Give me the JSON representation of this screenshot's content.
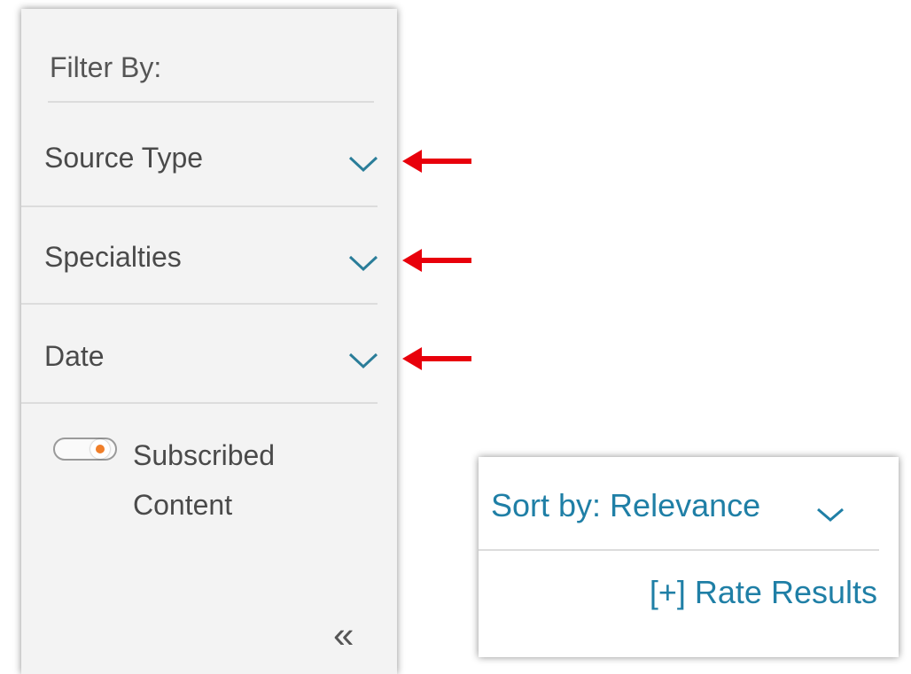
{
  "filter_panel": {
    "title": "Filter By:",
    "filters": [
      {
        "label": "Source Type",
        "icon": "chevron-down-icon"
      },
      {
        "label": "Specialties",
        "icon": "chevron-down-icon"
      },
      {
        "label": "Date",
        "icon": "chevron-down-icon"
      }
    ],
    "toggle": {
      "label_line1": "Subscribed",
      "label_line2": "Content",
      "state": "on"
    },
    "collapse_icon": "double-chevron-left-icon"
  },
  "annotations": {
    "arrow_icon": "arrow-left-icon",
    "arrow_color": "#e8000b"
  },
  "sort": {
    "label": "Sort by: Relevance",
    "icon": "chevron-down-icon",
    "rate_results": "[+] Rate Results"
  },
  "colors": {
    "link": "#1f7fa6",
    "chevron": "#2a7d99",
    "toggle_accent": "#f07f2a",
    "panel_bg": "#f3f3f3"
  }
}
